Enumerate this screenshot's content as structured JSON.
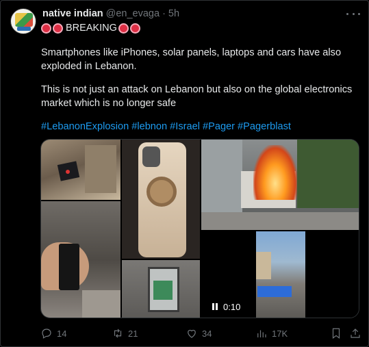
{
  "author": {
    "name": "native indian",
    "handle": "@en_evaga",
    "separator": "·",
    "time": "5h"
  },
  "tweet": {
    "breaking_label": "BREAKING",
    "paragraph1": "Smartphones like iPhones, solar panels, laptops and cars have also exploded in Lebanon.",
    "paragraph2": "This is not just an attack on Lebanon but also on the global electronics market which is no longer safe",
    "hashtags": [
      "#LebanonExplosion",
      "#lebnon",
      "#Israel",
      "#Pager",
      "#Pagerblast"
    ]
  },
  "media": {
    "video_time": "0:10"
  },
  "actions": {
    "replies": "14",
    "reposts": "21",
    "likes": "34",
    "views": "17K"
  },
  "icons": {
    "reply": "reply-icon",
    "repost": "repost-icon",
    "like": "heart-icon",
    "views": "views-icon",
    "bookmark": "bookmark-icon",
    "share": "share-icon",
    "more": "more-icon"
  },
  "colors": {
    "link": "#1d9bf0",
    "muted": "#71767b",
    "text": "#e7e9ea",
    "background": "#000000",
    "red_circle": "#dd2e44"
  }
}
